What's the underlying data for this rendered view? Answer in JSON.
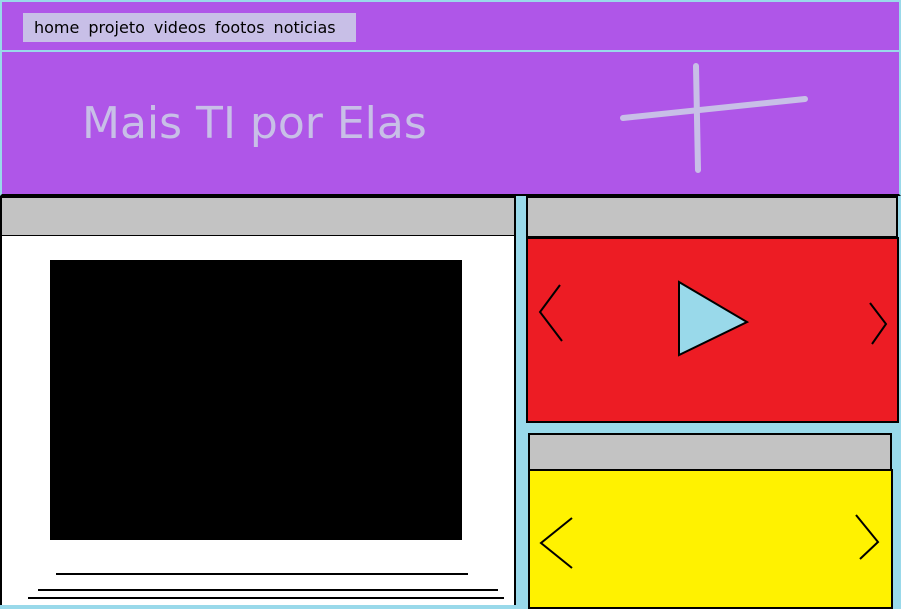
{
  "nav": {
    "items": [
      "home",
      "projeto",
      "videos",
      "footos",
      "noticias"
    ]
  },
  "banner": {
    "title": "Mais TI por Elas"
  },
  "colors": {
    "purple": "#af56e8",
    "lavender": "#c8bfe7",
    "light_blue": "#99d9ea",
    "gray": "#c3c3c3",
    "red": "#ed1c24",
    "yellow": "#fff200"
  },
  "icons": {
    "banner_mark": "cross-mark-icon",
    "prev": "chevron-left-icon",
    "next": "chevron-right-icon",
    "play": "play-icon"
  }
}
